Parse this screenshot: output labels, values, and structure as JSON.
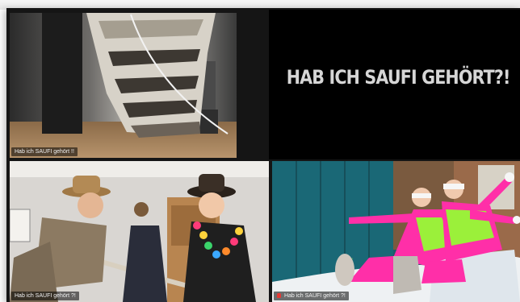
{
  "meeting": {
    "tiles": [
      {
        "participant_name": "Hab ich SAUFI gehört !!",
        "muted": false,
        "video_description": "close-up of a sneaker sole stepping toward the camera"
      },
      {
        "participant_name": "",
        "muted": false,
        "shared_text": "HAB ICH SAUFI GEHÖRT?!"
      },
      {
        "participant_name": "Hab ich SAUFI gehört ?!",
        "muted": false,
        "video_description": "two people in cowboy hats, one wearing a flower lei, holding a rope"
      },
      {
        "participant_name": "Hab ich SAUFI gehört ?!",
        "muted": true,
        "video_description": "two people in neon ski suits sitting in snow in front of a teal door"
      }
    ]
  },
  "colors": {
    "app_background": "#151515",
    "name_tag_background": "#000000",
    "muted_mic": "#e53935",
    "shared_text": "#d6d6d6",
    "neon_pink": "#ff2fa8",
    "neon_green": "#9bf03a"
  }
}
